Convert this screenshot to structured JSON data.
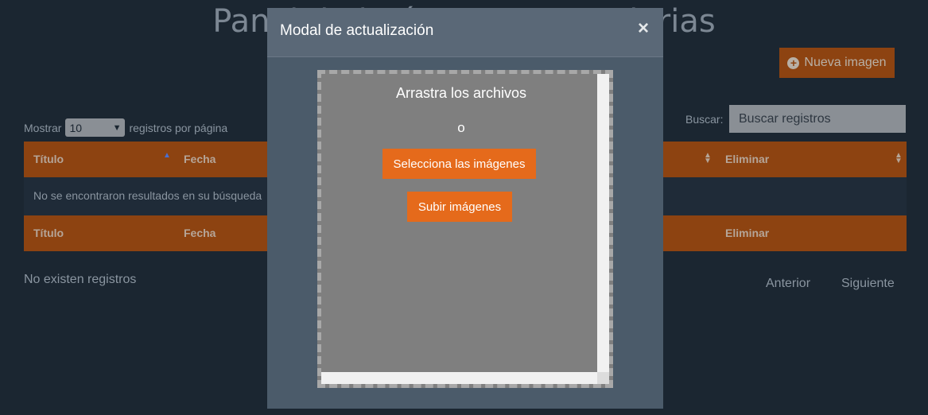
{
  "page": {
    "title": "Panel de imágenes secundarias",
    "new_button_label": "Nueva imagen"
  },
  "table_controls": {
    "show_label": "Mostrar",
    "page_size": "10",
    "per_page_label": "registros por página",
    "search_label": "Buscar:",
    "search_placeholder": "Buscar registros"
  },
  "table": {
    "columns": [
      "Título",
      "Fecha",
      "Eliminar"
    ],
    "empty_message": "No se encontraron resultados en su búsqueda"
  },
  "footer": {
    "info": "No existen registros",
    "prev": "Anterior",
    "next": "Siguiente"
  },
  "modal": {
    "title": "Modal de actualización",
    "close": "×",
    "dropzone_title": "Arrastra los archivos",
    "or": "o",
    "select_button": "Selecciona las imágenes",
    "upload_button": "Subir imágenes"
  },
  "colors": {
    "background": "#1b2631",
    "header_orange": "#8d4311",
    "accent_orange": "#e56a1b",
    "modal_bg": "#4b5b6a"
  }
}
